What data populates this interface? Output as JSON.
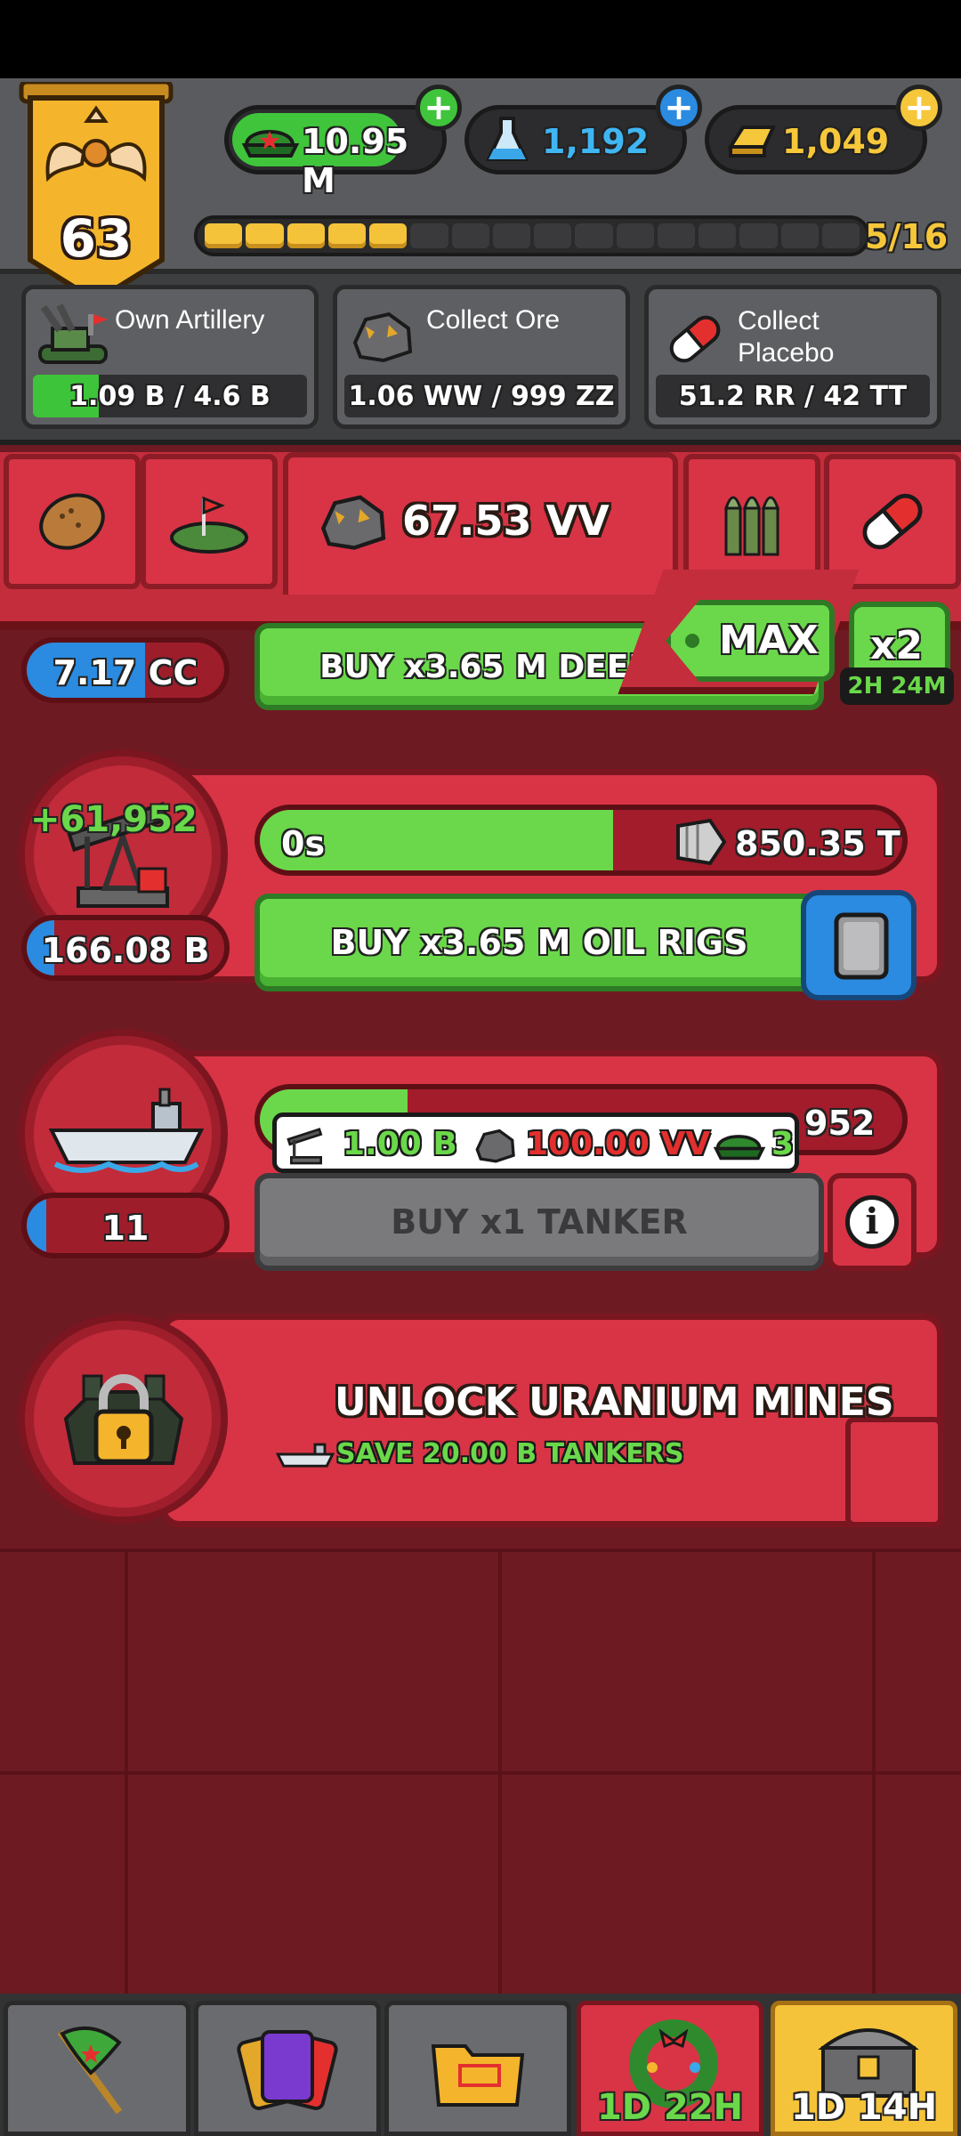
{
  "player": {
    "level": "63"
  },
  "resources": {
    "cash": "10.95 M",
    "science": "1,192",
    "gold": "1,049"
  },
  "level_progress": {
    "label": "5/16",
    "filled_segments": 5,
    "total_segments": 16
  },
  "quests": [
    {
      "title": "Own Artillery",
      "progress": "1.09 B / 4.6 B",
      "fraction": 0.24
    },
    {
      "title": "Collect Ore",
      "progress": "1.06 WW / 999 ZZ",
      "fraction": 0.0
    },
    {
      "title_lines": [
        "Collect",
        "Placebo"
      ],
      "progress": "51.2 RR / 42 TT",
      "fraction": 0.0
    }
  ],
  "category": {
    "selected_value": "67.53 VV"
  },
  "deep_row": {
    "count": "7.17 CC",
    "buy_label": "BUY x3.65 M DEEP",
    "max_label": "MAX",
    "boost_label": "x2",
    "boost_timer": "2H 24M"
  },
  "oil_row": {
    "income": "+61,952",
    "timer": "0s",
    "output": "850.35 T",
    "count": "166.08 B",
    "buy_label": "BUY x3.65 M OIL RIGS",
    "fill": 0.55
  },
  "tanker_row": {
    "count": "11",
    "partial_value": "952",
    "buy_label": "BUY x1 TANKER",
    "cost_oil": "1.00 B",
    "cost_ore": "100.00 VV",
    "cost_cash": "3",
    "fill": 0.2
  },
  "locked_row": {
    "title": "UNLOCK URANIUM MINES",
    "requirement": "SAVE 20.00 B TANKERS"
  },
  "nav": {
    "tab4_timer": "1D 22H",
    "tab5_timer": "1D 14H"
  },
  "colors": {
    "accent_red": "#d83446",
    "cash_green": "#6ad84a",
    "science_blue": "#2a8be0",
    "gold_yellow": "#f4c33a"
  }
}
